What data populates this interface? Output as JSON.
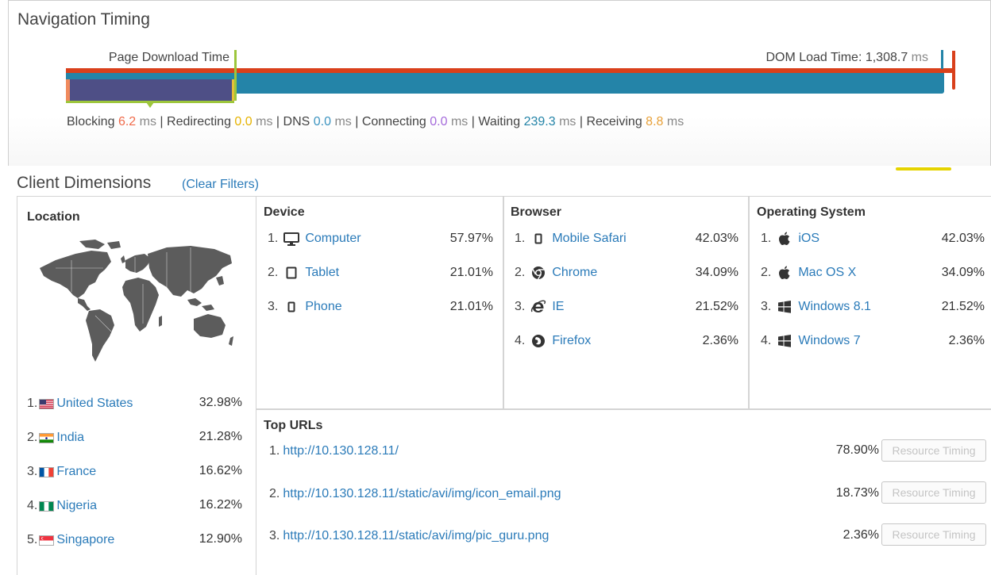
{
  "navigation_timing": {
    "title": "Navigation Timing",
    "page_download_label": "Page Download Time",
    "dom_load_label": "DOM Load Time: 1,308.7",
    "dom_load_unit": "ms",
    "phases": [
      {
        "label": "Blocking",
        "value": "6.2",
        "unit": "ms",
        "color": "#f06a4a"
      },
      {
        "label": "Redirecting",
        "value": "0.0",
        "unit": "ms",
        "color": "#e6b300"
      },
      {
        "label": "DNS",
        "value": "0.0",
        "unit": "ms",
        "color": "#3d94c0"
      },
      {
        "label": "Connecting",
        "value": "0.0",
        "unit": "ms",
        "color": "#a56bdb"
      },
      {
        "label": "Waiting",
        "value": "239.3",
        "unit": "ms",
        "color": "#2484a8"
      },
      {
        "label": "Receiving",
        "value": "8.8",
        "unit": "ms",
        "color": "#e8a13a"
      }
    ]
  },
  "client_dimensions": {
    "title": "Client Dimensions",
    "clear_filters": "(Clear Filters)",
    "location": {
      "heading": "Location",
      "items": [
        {
          "num": "1.",
          "name": "United States",
          "pct": "32.98%",
          "flag": "us-flag-icon"
        },
        {
          "num": "2.",
          "name": "India",
          "pct": "21.28%",
          "flag": "india-flag-icon"
        },
        {
          "num": "3.",
          "name": "France",
          "pct": "16.62%",
          "flag": "france-flag-icon"
        },
        {
          "num": "4.",
          "name": "Nigeria",
          "pct": "16.22%",
          "flag": "nigeria-flag-icon"
        },
        {
          "num": "5.",
          "name": "Singapore",
          "pct": "12.90%",
          "flag": "singapore-flag-icon"
        }
      ]
    },
    "device": {
      "heading": "Device",
      "items": [
        {
          "num": "1.",
          "name": "Computer",
          "pct": "57.97%",
          "icon": "monitor-icon"
        },
        {
          "num": "2.",
          "name": "Tablet",
          "pct": "21.01%",
          "icon": "tablet-icon"
        },
        {
          "num": "3.",
          "name": "Phone",
          "pct": "21.01%",
          "icon": "phone-icon"
        }
      ]
    },
    "browser": {
      "heading": "Browser",
      "items": [
        {
          "num": "1.",
          "name": "Mobile Safari",
          "pct": "42.03%",
          "icon": "phone-icon"
        },
        {
          "num": "2.",
          "name": "Chrome",
          "pct": "34.09%",
          "icon": "chrome-icon"
        },
        {
          "num": "3.",
          "name": "IE",
          "pct": "21.52%",
          "icon": "ie-icon"
        },
        {
          "num": "4.",
          "name": "Firefox",
          "pct": "2.36%",
          "icon": "firefox-icon"
        }
      ]
    },
    "os": {
      "heading": "Operating System",
      "items": [
        {
          "num": "1.",
          "name": "iOS",
          "pct": "42.03%",
          "icon": "apple-icon"
        },
        {
          "num": "2.",
          "name": "Mac OS X",
          "pct": "34.09%",
          "icon": "apple-icon"
        },
        {
          "num": "3.",
          "name": "Windows 8.1",
          "pct": "21.52%",
          "icon": "windows-icon"
        },
        {
          "num": "4.",
          "name": "Windows 7",
          "pct": "2.36%",
          "icon": "windows-icon"
        }
      ]
    },
    "top_urls": {
      "heading": "Top URLs",
      "button_label": "Resource Timing",
      "items": [
        {
          "num": "1.",
          "url": "http://10.130.128.11/",
          "pct": "78.90%"
        },
        {
          "num": "2.",
          "url": "http://10.130.128.11/static/avi/img/icon_email.png",
          "pct": "18.73%"
        },
        {
          "num": "3.",
          "url": "http://10.130.128.11/static/avi/img/pic_guru.png",
          "pct": "2.36%"
        }
      ]
    }
  }
}
